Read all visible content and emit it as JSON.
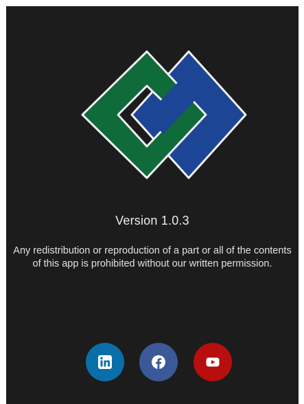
{
  "about": {
    "version_text": "Version 1.0.3",
    "notice_text": "Any redistribution or reproduction of a part or all of the contents of this app is prohibited without our written permission."
  },
  "logo": {
    "icon": "interlocking-diamonds-logo",
    "colors": {
      "green": "#0f6b3a",
      "blue": "#1d4596",
      "outline": "#f2f2f2"
    }
  },
  "socials": [
    {
      "icon": "linkedin-icon",
      "color": "#0a6fa8"
    },
    {
      "icon": "facebook-icon",
      "color": "#3b5998"
    },
    {
      "icon": "youtube-icon",
      "color": "#b80e0e"
    }
  ],
  "theme": {
    "background": "#1c1c1c",
    "text": "#ececec"
  }
}
